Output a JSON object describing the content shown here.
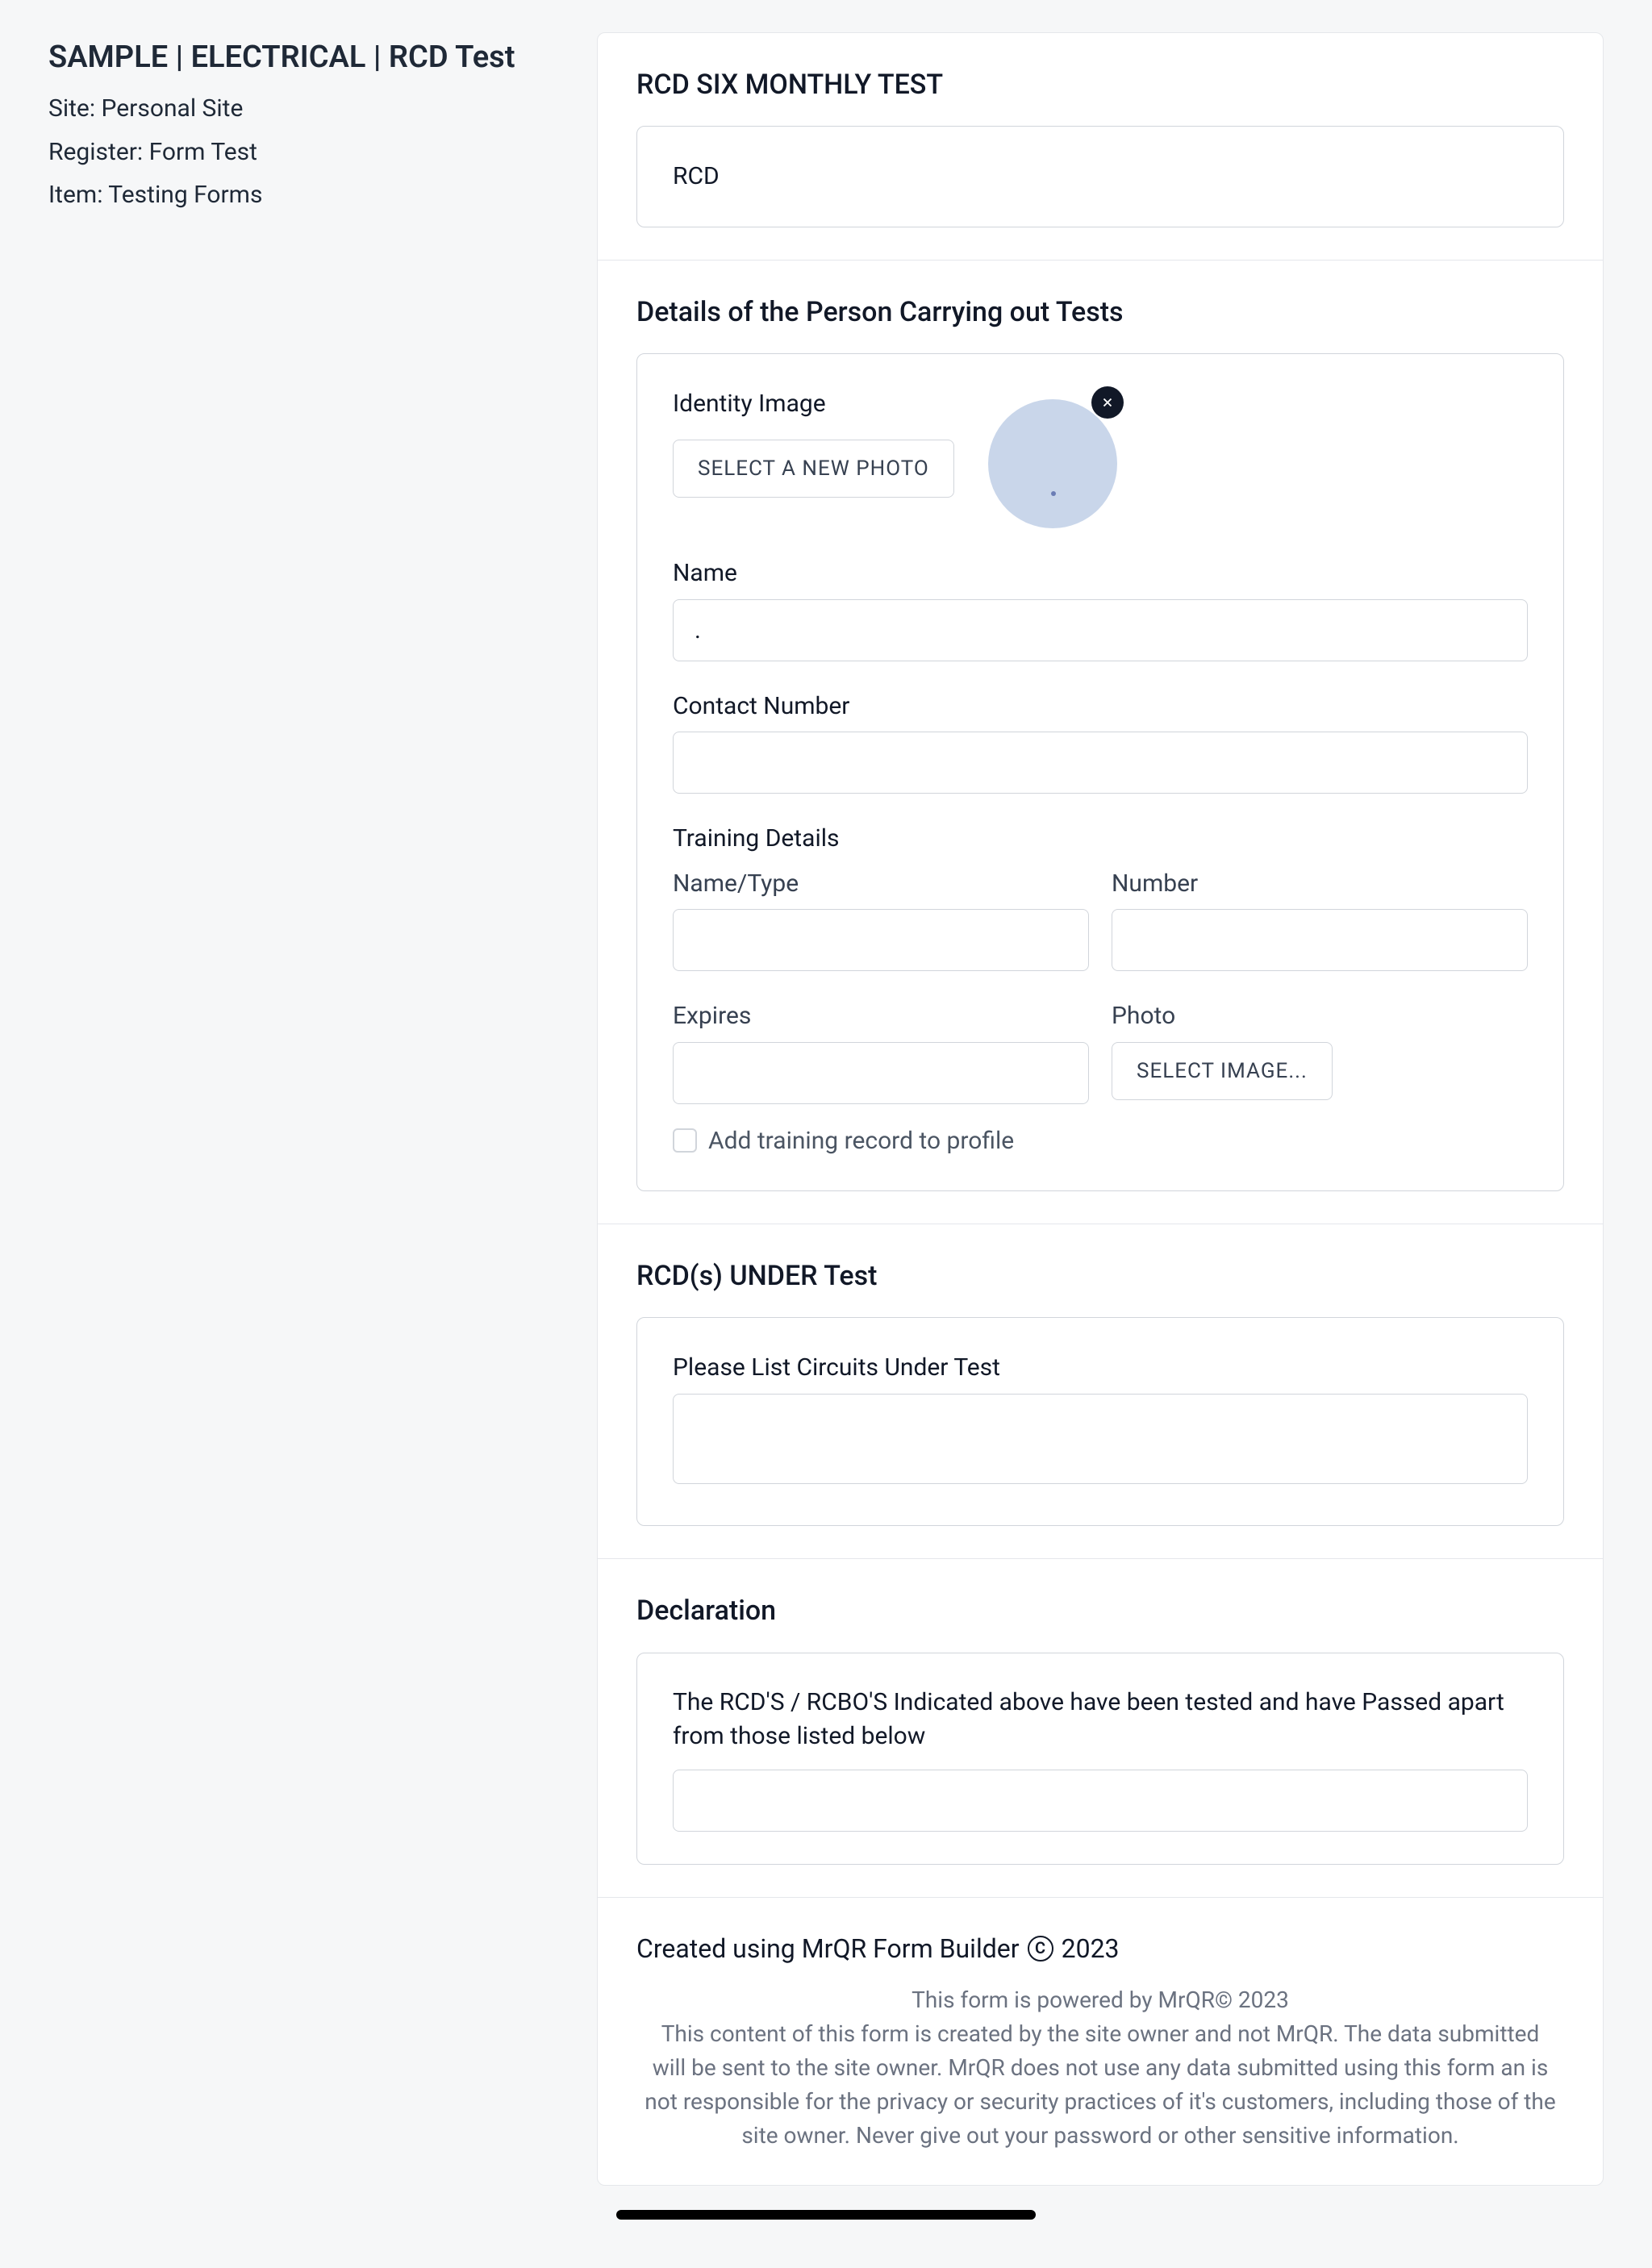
{
  "sidebar": {
    "title": "SAMPLE | ELECTRICAL | RCD Test",
    "site_label": "Site: Personal Site",
    "register_label": "Register: Form Test",
    "item_label": "Item: Testing Forms"
  },
  "section1": {
    "title": "RCD SIX MONTHLY TEST",
    "card_text": "RCD"
  },
  "section2": {
    "title": "Details of the Person Carrying out Tests",
    "identity_label": "Identity Image",
    "select_photo_btn": "Select A New Photo",
    "name_label": "Name",
    "name_value": ".",
    "contact_label": "Contact Number",
    "contact_value": "",
    "training_title": "Training Details",
    "name_type_label": "Name/Type",
    "name_type_value": "",
    "number_label": "Number",
    "number_value": "",
    "expires_label": "Expires",
    "expires_value": "",
    "photo_label": "Photo",
    "select_image_btn": "Select Image...",
    "checkbox_label": "Add training record to profile"
  },
  "section3": {
    "title": "RCD(s) UNDER Test",
    "circuits_label": "Please List Circuits Under Test",
    "circuits_value": ""
  },
  "section4": {
    "title": "Declaration",
    "declaration_text": "The RCD'S / RCBO'S Indicated above have been tested and have Passed apart from those listed below",
    "declaration_value": ""
  },
  "footer": {
    "created_prefix": "Created using MrQR Form Builder",
    "created_suffix": "2023",
    "powered": "This form is powered by MrQR© 2023",
    "disclaimer": "This content of this form is created by the site owner and not MrQR. The data submitted will be sent to the site owner. MrQR does not use any data submitted using this form an is not responsible for the privacy or security practices of it's customers, including those of the site owner. Never give out your password or other sensitive information."
  }
}
